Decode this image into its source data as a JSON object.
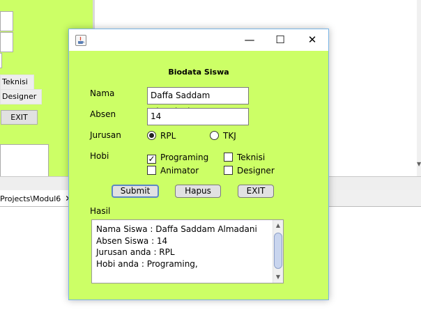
{
  "background_window": {
    "checkbox_teknisi": "Teknisi",
    "checkbox_designer": "Designer",
    "exit_label": "EXIT",
    "project_tab": "Projects\\Modul6",
    "tab_close": "✕"
  },
  "dialog": {
    "window_controls": {
      "minimize": "—",
      "maximize": "☐",
      "close": "✕"
    },
    "heading": "Biodata Siswa",
    "nama_label": "Nama",
    "nama_value": "Daffa Saddam Almadani",
    "absen_label": "Absen",
    "absen_value": "14",
    "jurusan_label": "Jurusan",
    "jurusan_options": [
      {
        "label": "RPL",
        "selected": true
      },
      {
        "label": "TKJ",
        "selected": false
      }
    ],
    "hobi_label": "Hobi",
    "hobi_options": [
      {
        "label": "Programing",
        "checked": true
      },
      {
        "label": "Teknisi",
        "checked": false
      },
      {
        "label": "Animator",
        "checked": false
      },
      {
        "label": "Designer",
        "checked": false
      }
    ],
    "buttons": {
      "submit": "Submit",
      "hapus": "Hapus",
      "exit": "EXIT"
    },
    "hasil_label": "Hasil",
    "hasil_lines": [
      "Nama Siswa : Daffa Saddam Almadani",
      "Absen Siswa : 14",
      "Jurusan anda : RPL",
      "Hobi anda : Programing,"
    ],
    "scroll_up": "▲",
    "scroll_down": "▼"
  },
  "colors": {
    "form_background": "#ccff66",
    "dialog_border": "#79b5e6",
    "default_button_border": "#5b86c4"
  }
}
